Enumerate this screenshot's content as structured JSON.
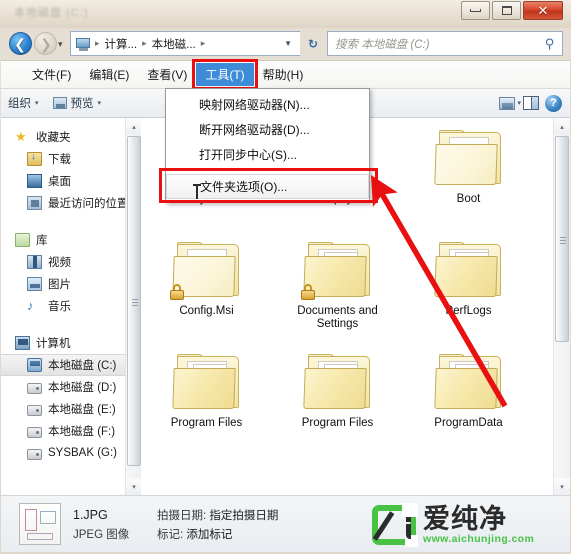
{
  "window": {
    "title": "本地磁盘 (C:)",
    "controls": {
      "minimize": "最小化",
      "maximize": "还原",
      "close": "✕"
    }
  },
  "addressbar": {
    "back_label": "❮",
    "forward_label": "❯",
    "recent_label": "▾",
    "breadcrumbs": [
      "计算...",
      "本地磁..."
    ],
    "separator": "▸",
    "dropdown_label": "▼",
    "refresh_label": "↻"
  },
  "search": {
    "placeholder": "搜索 本地磁盘 (C:)",
    "icon": "search-icon"
  },
  "menubar": {
    "items": [
      {
        "label": "文件(F)",
        "active": false
      },
      {
        "label": "编辑(E)",
        "active": false
      },
      {
        "label": "查看(V)",
        "active": false
      },
      {
        "label": "工具(T)",
        "active": true
      },
      {
        "label": "帮助(H)",
        "active": false
      }
    ],
    "highlight_color": "#e81010",
    "active_color": "#3c8cd8"
  },
  "toolbar": {
    "organize_label": "组织",
    "preview_label": "预览",
    "overflow_label": "»",
    "caret": "▾",
    "help_label": "?"
  },
  "dropdown": {
    "items": [
      {
        "label": "映射网络驱动器(N)...",
        "hover": false
      },
      {
        "label": "断开网络驱动器(D)...",
        "hover": false
      },
      {
        "label": "打开同步中心(S)...",
        "hover": false
      },
      {
        "label": "文件夹选项(O)...",
        "hover": true
      }
    ],
    "highlighted_index": 3,
    "highlight_color": "#e81010"
  },
  "sidebar": {
    "groups": [
      {
        "header": {
          "label": "收藏夹",
          "icon": "star-icon"
        },
        "items": [
          {
            "label": "下载",
            "icon": "downloads-icon",
            "selected": false
          },
          {
            "label": "桌面",
            "icon": "desktop-icon",
            "selected": false
          },
          {
            "label": "最近访问的位置",
            "icon": "recent-places-icon",
            "selected": false
          }
        ]
      },
      {
        "header": {
          "label": "库",
          "icon": "library-icon"
        },
        "items": [
          {
            "label": "视频",
            "icon": "video-icon",
            "selected": false
          },
          {
            "label": "图片",
            "icon": "pictures-icon",
            "selected": false
          },
          {
            "label": "音乐",
            "icon": "music-icon",
            "selected": false
          }
        ]
      },
      {
        "header": {
          "label": "计算机",
          "icon": "computer-icon"
        },
        "items": [
          {
            "label": "本地磁盘 (C:)",
            "icon": "drive-c-icon",
            "selected": true
          },
          {
            "label": "本地磁盘 (D:)",
            "icon": "drive-icon",
            "selected": false
          },
          {
            "label": "本地磁盘 (E:)",
            "icon": "drive-icon",
            "selected": false
          },
          {
            "label": "本地磁盘 (F:)",
            "icon": "drive-icon",
            "selected": false
          },
          {
            "label": "SYSBAK (G:)",
            "icon": "drive-icon",
            "selected": false
          }
        ]
      }
    ],
    "scrollbar": {
      "up": "▴",
      "down": "▾"
    }
  },
  "content": {
    "files": [
      {
        "name": "$Recycle.Bin",
        "type": "folder-empty",
        "locked": true
      },
      {
        "name": "alipay",
        "type": "folder-full",
        "locked": false
      },
      {
        "name": "Boot",
        "type": "folder-empty",
        "locked": false
      },
      {
        "name": "Config.Msi",
        "type": "folder-empty",
        "locked": true
      },
      {
        "name": "Documents and Settings",
        "type": "folder-full",
        "locked": true
      },
      {
        "name": "PerfLogs",
        "type": "folder-full",
        "locked": false
      },
      {
        "name": "Program Files",
        "type": "folder-full",
        "locked": false
      },
      {
        "name": "Program Files",
        "type": "folder-full",
        "locked": false
      },
      {
        "name": "ProgramData",
        "type": "folder-full",
        "locked": false
      }
    ],
    "scrollbar": {
      "up": "▴",
      "down": "▾"
    }
  },
  "statusbar": {
    "file_name": "1.JPG",
    "file_type": "JPEG 图像",
    "date_label": "拍摄日期:",
    "date_value": "指定拍摄日期",
    "tags_label": "标记:",
    "tags_value": "添加标记"
  },
  "watermark": {
    "brand": "爱纯净",
    "url": "www.aichunjing.com",
    "color": "#47c244"
  }
}
